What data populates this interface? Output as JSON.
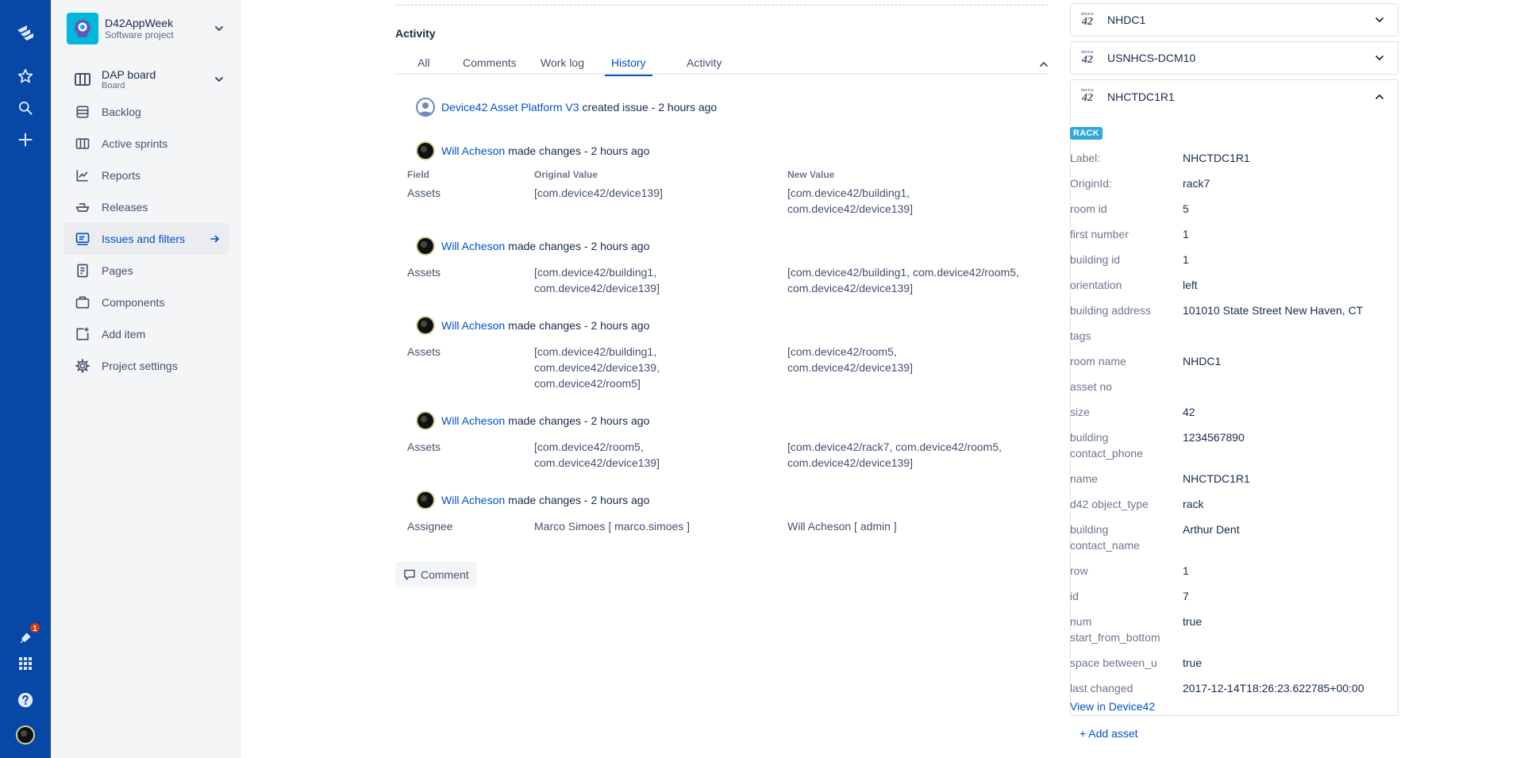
{
  "project": {
    "name": "D42AppWeek",
    "type": "Software project"
  },
  "board": {
    "name": "DAP board",
    "sub": "Board"
  },
  "nav": [
    {
      "label": "Backlog",
      "icon": "backlog-icon"
    },
    {
      "label": "Active sprints",
      "icon": "board-icon"
    },
    {
      "label": "Reports",
      "icon": "chart-icon"
    },
    {
      "label": "Releases",
      "icon": "ship-icon"
    },
    {
      "label": "Issues and filters",
      "icon": "issues-icon",
      "active": true
    },
    {
      "label": "Pages",
      "icon": "page-icon"
    },
    {
      "label": "Components",
      "icon": "component-icon"
    },
    {
      "label": "Add item",
      "icon": "add-item-icon"
    },
    {
      "label": "Project settings",
      "icon": "gear-icon"
    }
  ],
  "notifications_count": "1",
  "activity": {
    "title": "Activity",
    "tabs": [
      "All",
      "Comments",
      "Work log",
      "History",
      "Activity"
    ],
    "active_tab": "History",
    "created": {
      "user": "Device42 Asset Platform V3",
      "text": "created issue - 2 hours ago"
    },
    "headers": {
      "field": "Field",
      "original": "Original Value",
      "new": "New Value"
    },
    "changes": [
      {
        "user": "Will Acheson",
        "text": "made changes - 2 hours ago",
        "field": "Assets",
        "original": [
          "[com.device42/device139]"
        ],
        "new": [
          "[com.device42/building1,",
          "com.device42/device139]"
        ]
      },
      {
        "user": "Will Acheson",
        "text": "made changes - 2 hours ago",
        "field": "Assets",
        "original": [
          "[com.device42/building1,",
          "com.device42/device139]"
        ],
        "new": [
          "[com.device42/building1, com.device42/room5,",
          "com.device42/device139]"
        ]
      },
      {
        "user": "Will Acheson",
        "text": "made changes - 2 hours ago",
        "field": "Assets",
        "original": [
          "[com.device42/building1,",
          "com.device42/device139,",
          "com.device42/room5]"
        ],
        "new": [
          "[com.device42/room5,",
          "com.device42/device139]"
        ]
      },
      {
        "user": "Will Acheson",
        "text": "made changes - 2 hours ago",
        "field": "Assets",
        "original": [
          "[com.device42/room5,",
          "com.device42/device139]"
        ],
        "new": [
          "[com.device42/rack7, com.device42/room5,",
          "com.device42/device139]"
        ]
      },
      {
        "user": "Will Acheson",
        "text": "made changes - 2 hours ago",
        "field": "Assignee",
        "original": [
          "Marco Simoes [ marco.simoes ]"
        ],
        "new": [
          "Will Acheson [ admin ]"
        ]
      }
    ],
    "comment_button": "Comment"
  },
  "assets": {
    "collapsed": [
      {
        "name": "NHDC1",
        "logo_small": "device",
        "logo_big": "42"
      },
      {
        "name": "USNHCS-DCM10",
        "logo_small": "device",
        "logo_big": "42"
      }
    ],
    "expanded": {
      "name": "NHCTDC1R1",
      "logo_small": "device",
      "logo_big": "42",
      "lozenge": "RACK",
      "props": [
        {
          "key": "Label:",
          "value": "NHCTDC1R1"
        },
        {
          "key": "OriginId:",
          "value": "rack7"
        },
        {
          "key": "room id",
          "value": "5"
        },
        {
          "key": "first number",
          "value": "1"
        },
        {
          "key": "building id",
          "value": "1"
        },
        {
          "key": "orientation",
          "value": "left"
        },
        {
          "key": "building address",
          "value": "101010 State Street New Haven, CT"
        },
        {
          "key": "tags",
          "value": ""
        },
        {
          "key": "room name",
          "value": "NHDC1"
        },
        {
          "key": "asset no",
          "value": ""
        },
        {
          "key": "size",
          "value": "42"
        },
        {
          "key": "building contact_phone",
          "value": "1234567890"
        },
        {
          "key": "name",
          "value": "NHCTDC1R1"
        },
        {
          "key": "d42 object_type",
          "value": "rack"
        },
        {
          "key": "building contact_name",
          "value": "Arthur Dent"
        },
        {
          "key": "row",
          "value": "1"
        },
        {
          "key": "id",
          "value": "7"
        },
        {
          "key": "num start_from_bottom",
          "value": "true"
        },
        {
          "key": "space between_u",
          "value": "true"
        },
        {
          "key": "last changed",
          "value": "2017-12-14T18:26:23.622785+00:00"
        }
      ],
      "view_link": "View in Device42"
    },
    "add_asset": "+ Add asset"
  }
}
